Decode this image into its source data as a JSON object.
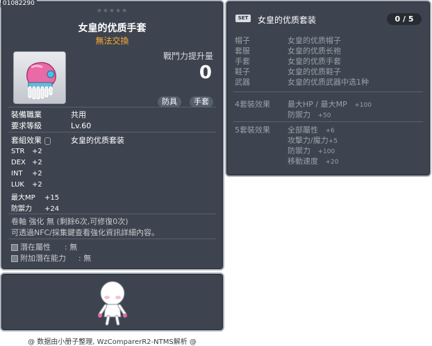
{
  "item_id": "01082290",
  "stars": "★★★★★",
  "item": {
    "name": "女皇的优质手套",
    "trade_note": "無法交換",
    "power_label": "戰鬥力提升量",
    "power_value": "0",
    "tags": [
      "防具",
      "手套"
    ],
    "job_label": "裝備職業",
    "job_value": "共用",
    "level_label": "要求等級",
    "level_value": "Lv.60",
    "set_label": "套組效果",
    "set_value": "女皇的优质套装",
    "stats": [
      {
        "name": "STR",
        "value": "+2"
      },
      {
        "name": "DEX",
        "value": "+2"
      },
      {
        "name": "INT",
        "value": "+2"
      },
      {
        "name": "LUK",
        "value": "+2"
      },
      {
        "name": "最大MP",
        "value": "+15"
      },
      {
        "name": "防禦力",
        "value": "+24"
      }
    ],
    "scroll_line": "卷軸 強化 無 (剩餘6次,可修復0次)",
    "enhance_note": "可透過NFC/採集鍵查看強化資訊詳細內容。",
    "potential_label": "潛在屬性",
    "potential_value": ": 無",
    "bonus_potential_label": "附加潛在能力",
    "bonus_potential_value": ": 無"
  },
  "credit": "@ 数据由小册子整理, WzComparerR2-NTMS解析 @",
  "set": {
    "badge": "SET",
    "title": "女皇的优质套装",
    "count": "0 / 5",
    "parts": [
      {
        "slot": "帽子",
        "name": "女皇的优质帽子"
      },
      {
        "slot": "套服",
        "name": "女皇的优质长袍"
      },
      {
        "slot": "手套",
        "name": "女皇的优质手套"
      },
      {
        "slot": "鞋子",
        "name": "女皇的优质鞋子"
      },
      {
        "slot": "武器",
        "name": "女皇的优质武器中选1种"
      }
    ],
    "effect4_label": "4套裝效果",
    "effect4": [
      {
        "name": "最大HP / 最大MP",
        "value": "+100"
      },
      {
        "name": "防禦力",
        "value": "+50"
      }
    ],
    "effect5_label": "5套裝效果",
    "effect5": [
      {
        "name": "全部屬性",
        "value": "+6"
      },
      {
        "name": "攻擊力/魔力",
        "value": "+5"
      },
      {
        "name": "防禦力",
        "value": "+100"
      },
      {
        "name": "移動速度",
        "value": "+20"
      }
    ]
  }
}
